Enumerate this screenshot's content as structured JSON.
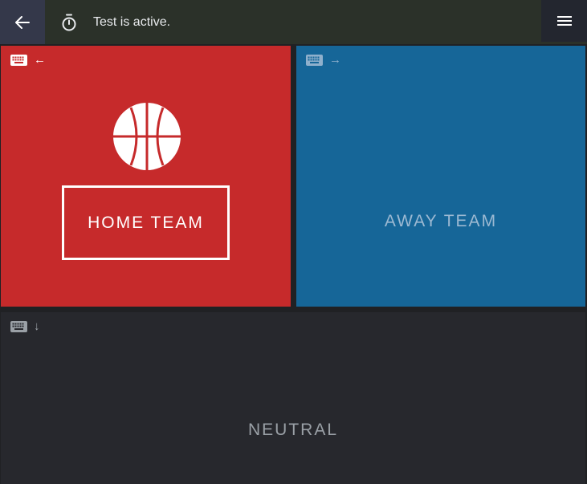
{
  "topbar": {
    "status_text": "Test is active.",
    "back_icon": "arrow-left-icon",
    "timer_icon": "stopwatch-icon",
    "menu_icon": "hamburger-menu-icon"
  },
  "panels": {
    "home": {
      "label": "HOME TEAM",
      "key_arrow": "←",
      "color": "#c62a2b",
      "icon": "basketball-icon",
      "selected": true
    },
    "away": {
      "label": "AWAY TEAM",
      "key_arrow": "→",
      "color": "#166698"
    },
    "neutral": {
      "label": "NEUTRAL",
      "key_arrow": "↓",
      "color": "#27282d"
    }
  },
  "keyboard_icon": "keyboard-icon"
}
